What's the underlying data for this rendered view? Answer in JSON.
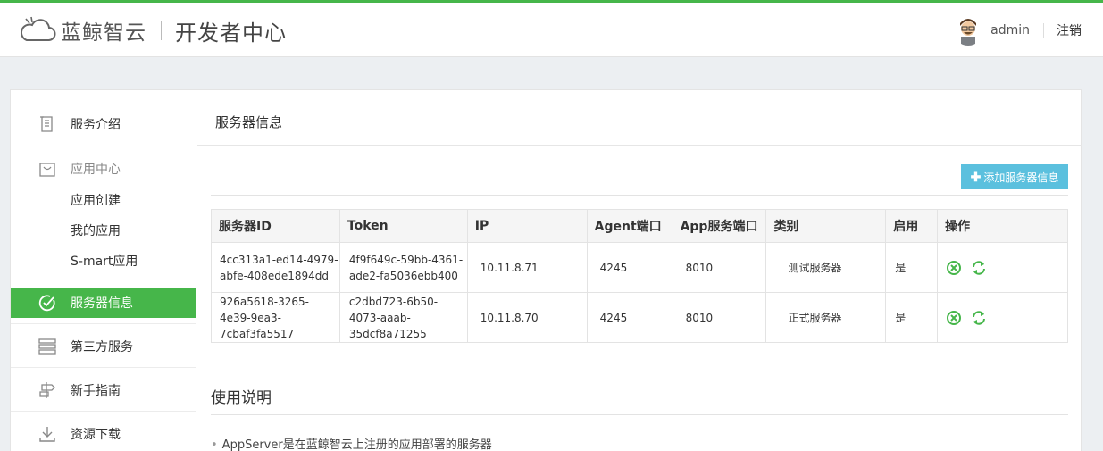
{
  "header": {
    "brand": "蓝鲸智云",
    "subtitle": "开发者中心",
    "username": "admin",
    "logout": "注销"
  },
  "sidebar": {
    "items": [
      {
        "label": "服务介绍",
        "icon": "document-icon"
      },
      {
        "label": "应用中心",
        "icon": "bag-icon"
      },
      {
        "label": "应用创建"
      },
      {
        "label": "我的应用"
      },
      {
        "label": "S-mart应用"
      },
      {
        "label": "服务器信息",
        "icon": "check-circle-icon",
        "active": true
      },
      {
        "label": "第三方服务",
        "icon": "server-icon"
      },
      {
        "label": "新手指南",
        "icon": "signpost-icon"
      },
      {
        "label": "资源下载",
        "icon": "download-icon"
      }
    ]
  },
  "main": {
    "title": "服务器信息",
    "add_button": "添加服务器信息",
    "table": {
      "headers": [
        "服务器ID",
        "Token",
        "IP",
        "Agent端口",
        "App服务端口",
        "类别",
        "启用",
        "操作"
      ],
      "rows": [
        {
          "id": "4cc313a1-ed14-4979-abfe-408ede1894dd",
          "token": "4f9f649c-59bb-4361-ade2-fa5036ebb400",
          "ip": "10.11.8.71",
          "agent_port": "4245",
          "app_port": "8010",
          "type": "测试服务器",
          "enabled": "是"
        },
        {
          "id": "926a5618-3265-4e39-9ea3-7cbaf3fa5517",
          "token": "c2dbd723-6b50-4073-aaab-35dcf8a71255",
          "ip": "10.11.8.70",
          "agent_port": "4245",
          "app_port": "8010",
          "type": "正式服务器",
          "enabled": "是"
        }
      ]
    },
    "usage_title": "使用说明",
    "usage_items": [
      "AppServer是在蓝鲸智云上注册的应用部署的服务器"
    ]
  },
  "colors": {
    "accent": "#46b64a",
    "button": "#5bc0de"
  }
}
